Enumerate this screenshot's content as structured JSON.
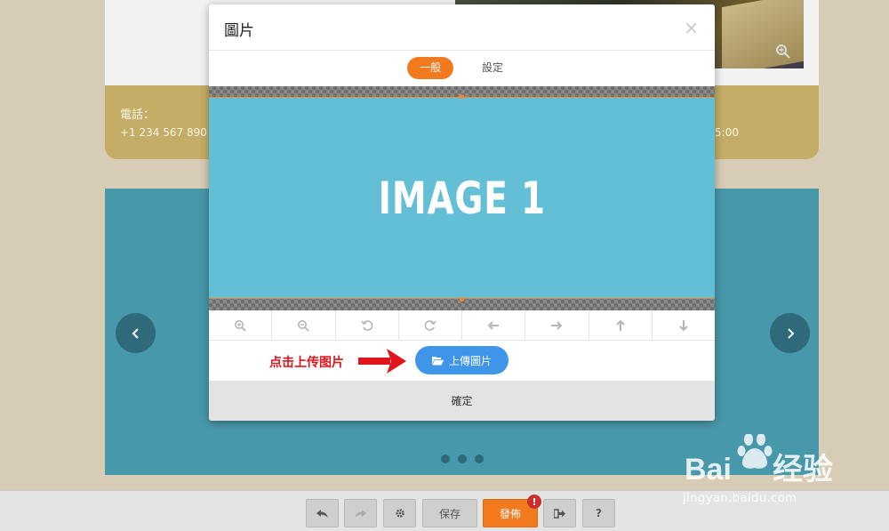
{
  "background": {
    "phone_label": "電話：",
    "phone_number": "+1 234 567 890",
    "hours_fragment": "5:00",
    "slider_dots": 3
  },
  "modal": {
    "title": "圖片",
    "close_glyph": "×",
    "tabs": [
      {
        "label": "一般",
        "active": true
      },
      {
        "label": "設定",
        "active": false
      }
    ],
    "image_placeholder": "IMAGE 1",
    "tools": [
      "zoom-in-icon",
      "zoom-out-icon",
      "rotate-left-icon",
      "rotate-right-icon",
      "arrow-left-icon",
      "arrow-right-icon",
      "arrow-up-icon",
      "arrow-down-icon"
    ],
    "annotation": "点击上传图片",
    "upload_label": "上傳圖片",
    "confirm_label": "確定"
  },
  "toolbar": {
    "save_label": "保存",
    "publish_label": "發佈",
    "alert_badge": "!",
    "help_label": "?"
  },
  "watermark": {
    "url": "jingyan.baidu.com"
  },
  "colors": {
    "accent": "#f27a1e",
    "primary_button": "#3e95ea",
    "image_bg": "#63bfd6",
    "slider_bg": "#4898ab"
  }
}
